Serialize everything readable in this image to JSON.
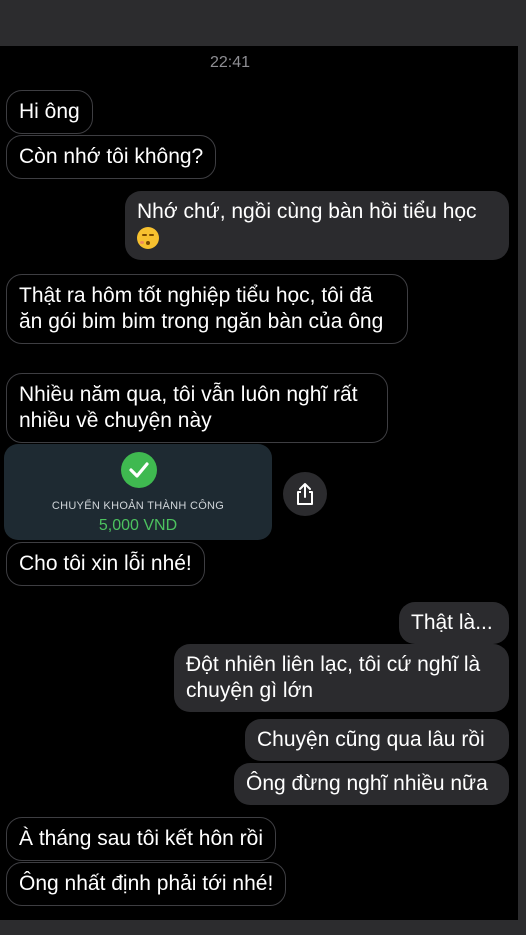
{
  "chat": {
    "timestamp": "22:41",
    "messages": [
      {
        "side": "in",
        "text": "Hi ông"
      },
      {
        "side": "in",
        "text": "Còn nhớ tôi không?"
      },
      {
        "side": "out",
        "text": "Nhớ chứ, ngồi cùng bàn hồi tiểu học",
        "emoji": "kissing-face-icon"
      },
      {
        "side": "in",
        "text": "Thật ra hôm tốt nghiệp tiểu học, tôi đã ăn gói bim bim trong ngăn bàn của ông"
      },
      {
        "side": "in",
        "text": "Nhiều năm qua, tôi vẫn luôn nghĩ rất nhiều về chuyện này"
      },
      {
        "side": "in",
        "text": "Cho tôi xin lỗi nhé!"
      },
      {
        "side": "out",
        "text": "Thật là..."
      },
      {
        "side": "out",
        "text": "Đột nhiên liên lạc, tôi cứ nghĩ là chuyện gì lớn"
      },
      {
        "side": "out",
        "text": "Chuyện cũng qua lâu rồi"
      },
      {
        "side": "out",
        "text": "Ông đừng nghĩ nhiều nữa"
      },
      {
        "side": "in",
        "text": "À tháng sau tôi kết hôn rồi"
      },
      {
        "side": "in",
        "text": "Ông nhất định phải tới nhé!"
      }
    ],
    "transfer": {
      "title": "CHUYỂN KHOẢN THÀNH CÔNG",
      "amount": "5,000 VND",
      "status_icon": "check-icon",
      "color": "#3fb950"
    },
    "share_icon": "share-icon"
  },
  "colors": {
    "background": "#000000",
    "incoming_border": "#3e3e42",
    "outgoing_bubble": "#2b2b2e",
    "timestamp": "#8e8e93"
  }
}
